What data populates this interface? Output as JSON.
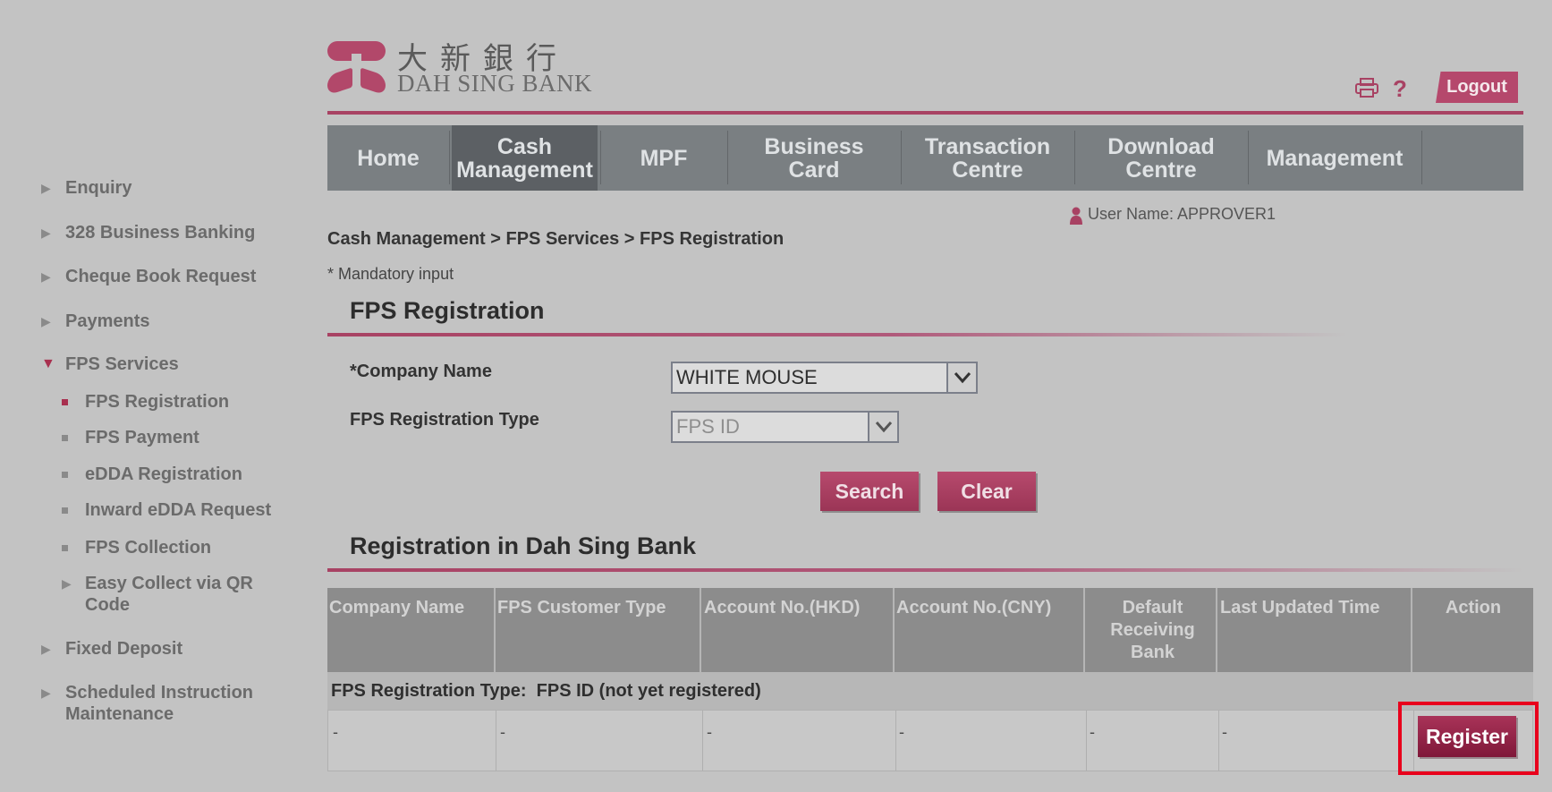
{
  "brand": {
    "chinese_name": "大新銀行",
    "english_name": "DAH SING BANK"
  },
  "header": {
    "logout_label": "Logout",
    "print_icon": "printer-icon",
    "help_symbol": "?",
    "user_name": "User Name: APPROVER1"
  },
  "nav": {
    "home": "Home",
    "cash_management": "Cash Management",
    "mpf": "MPF",
    "business_card": "Business Card",
    "transaction_centre": "Transaction Centre",
    "download_centre": "Download Centre",
    "management": "Management"
  },
  "sidebar": {
    "enquiry": "Enquiry",
    "business_banking": "328 Business Banking",
    "cheque_book": "Cheque Book Request",
    "payments": "Payments",
    "fps_services": "FPS Services",
    "fps_registration": "FPS Registration",
    "fps_payment": "FPS Payment",
    "edda_registration": "eDDA Registration",
    "inward_edda": "Inward eDDA Request",
    "fps_collection": "FPS Collection",
    "easy_collect": "Easy Collect via QR Code",
    "fixed_deposit": "Fixed Deposit",
    "scheduled_instruction": "Scheduled Instruction Maintenance"
  },
  "breadcrumb": "Cash Management > FPS Services > FPS Registration",
  "mandatory_note": "* Mandatory input",
  "form": {
    "title": "FPS Registration",
    "company_name_label": "*Company Name",
    "company_name_value": "WHITE MOUSE",
    "reg_type_label": "FPS Registration Type",
    "reg_type_value": "FPS ID",
    "search_label": "Search",
    "clear_label": "Clear"
  },
  "results": {
    "title": "Registration in Dah Sing Bank",
    "columns": [
      "Company Name",
      "FPS Customer Type",
      "Account No.(HKD)",
      "Account No.(CNY)",
      "Default Receiving Bank",
      "Last Updated Time",
      "Action"
    ],
    "type_row": "FPS Registration Type:  FPS ID (not yet registered)",
    "row": [
      "-",
      "-",
      "-",
      "-",
      "-",
      "-"
    ],
    "register_label": "Register"
  },
  "colors": {
    "brand_red": "#b5486c",
    "highlight": "#e8001c",
    "nav_bg": "#7a7f82"
  }
}
